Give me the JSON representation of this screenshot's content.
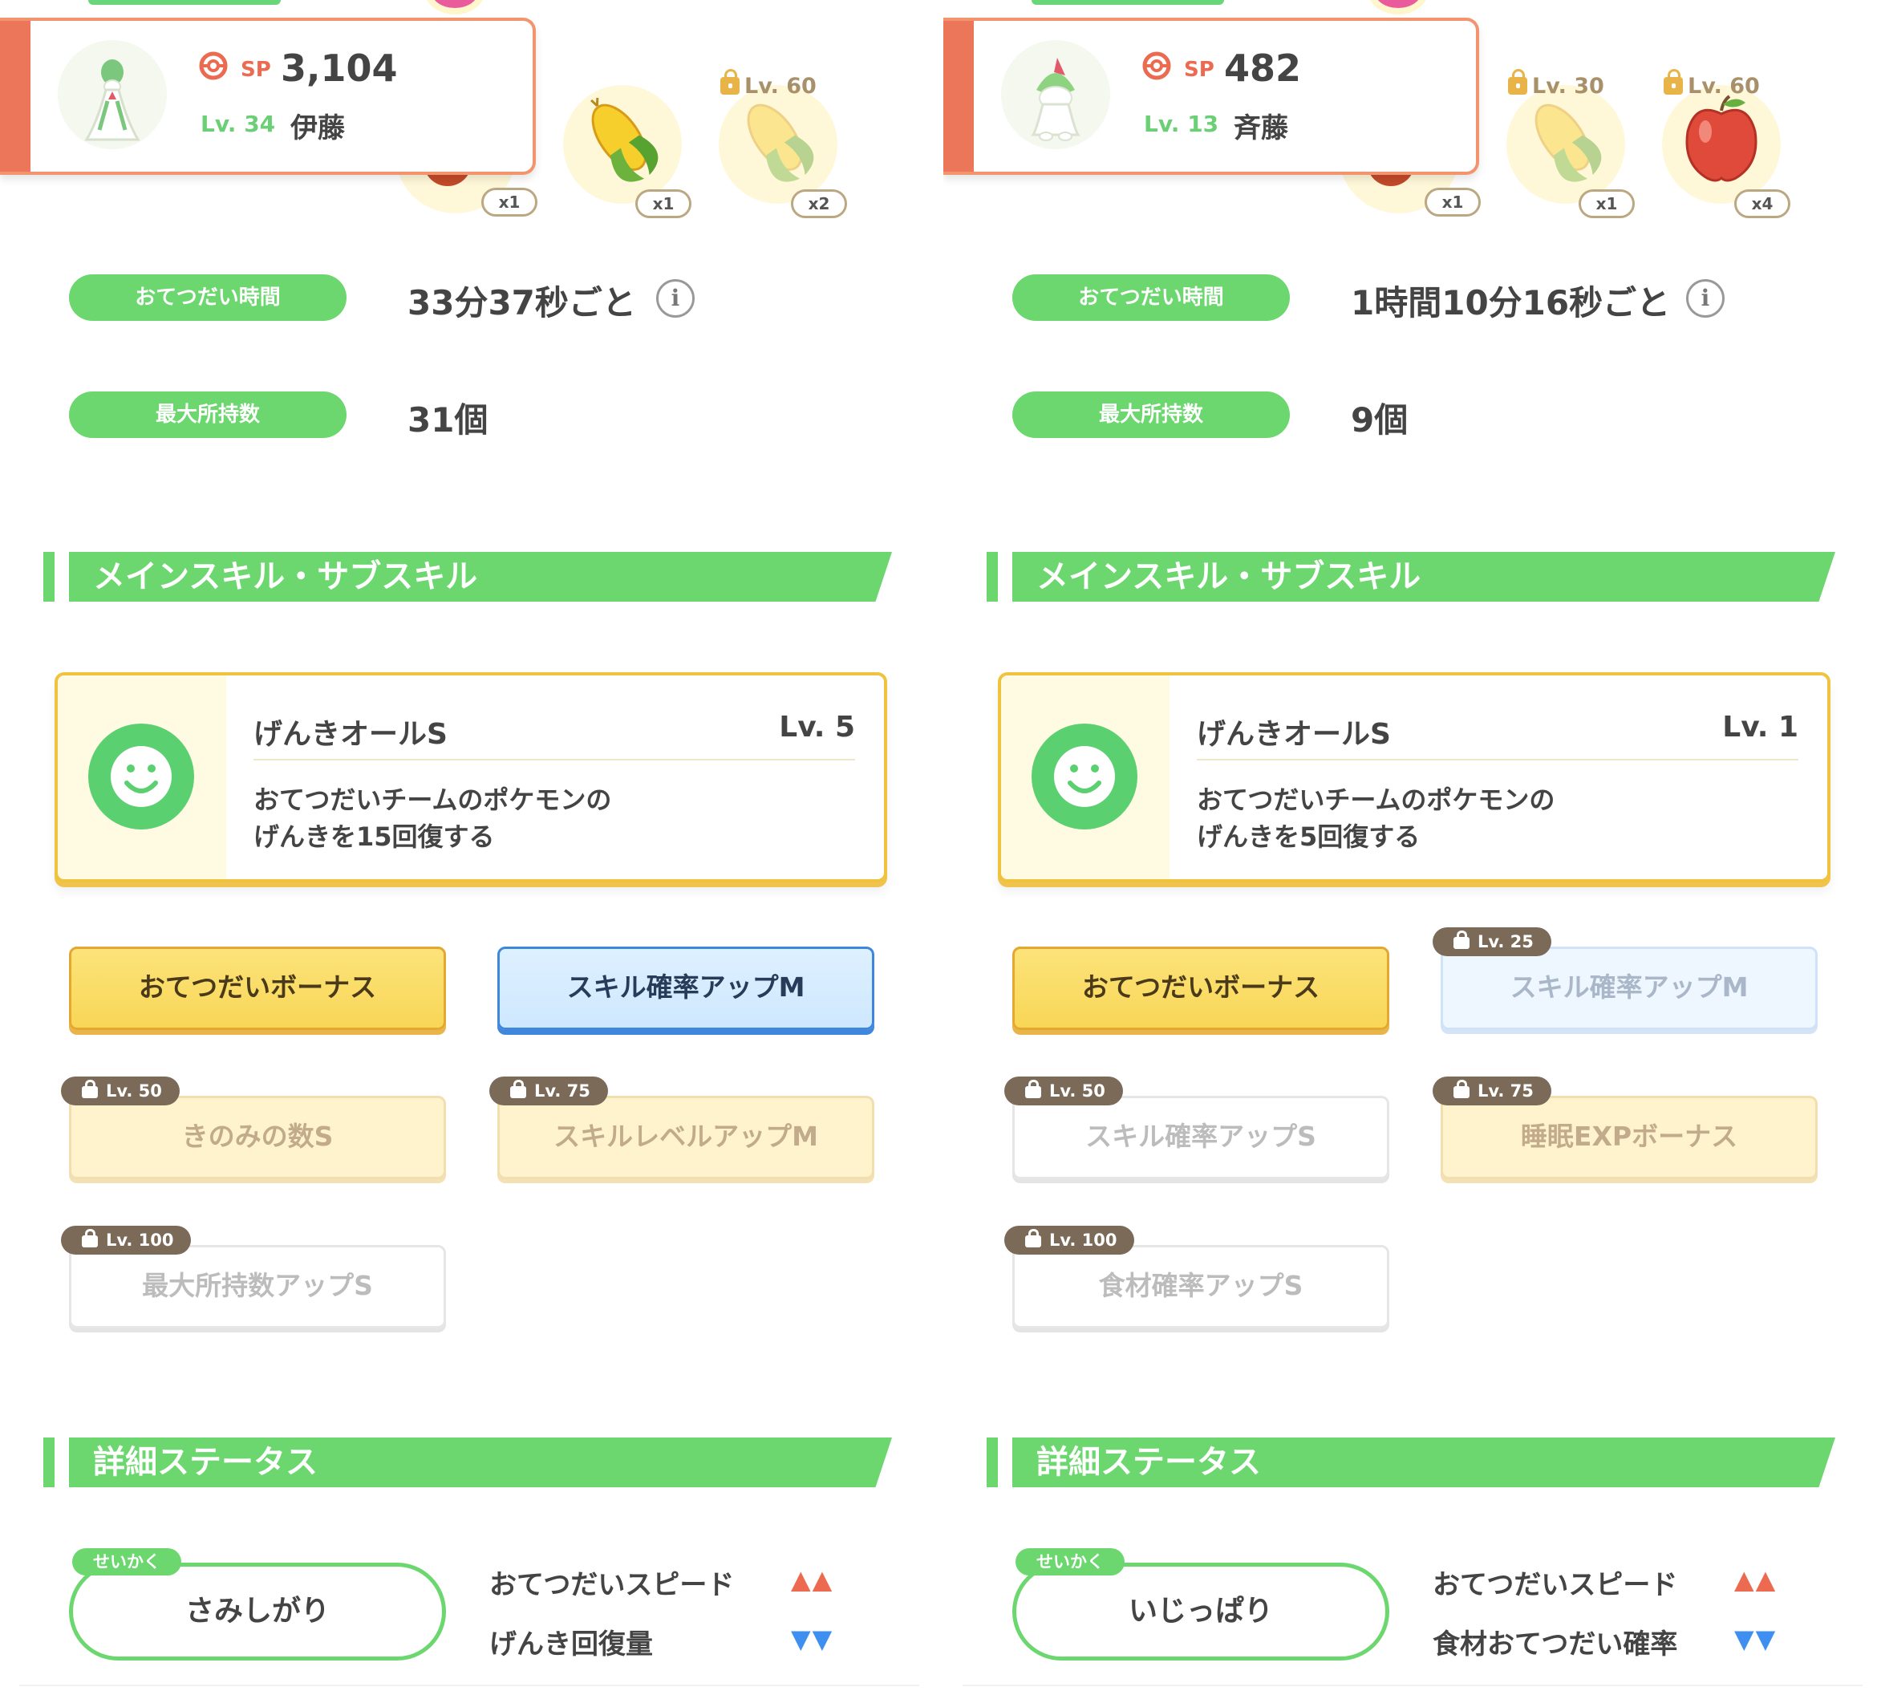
{
  "panels": [
    {
      "sp_label": "SP",
      "sp_value": "3,104",
      "level": "Lv. 34",
      "trainer": "伊藤",
      "ingredients": [
        {
          "icon": "corn-icon",
          "qty": "x1",
          "locked": false,
          "lock_level": ""
        },
        {
          "icon": "corn-icon",
          "qty": "x2",
          "locked": true,
          "lock_level": "Lv. 60"
        }
      ],
      "behind_qty": "x1",
      "help_time_label": "おてつだい時間",
      "help_time_value": "33分37秒ごと",
      "info_glyph": "i",
      "max_carry_label": "最大所持数",
      "max_carry_value": "31個",
      "skills_header": "メインスキル・サブスキル",
      "main_skill": {
        "name": "げんきオールS",
        "level": "Lv. 5",
        "desc_line1": "おてつだいチームのポケモンの",
        "desc_line2": "げんきを15回復する"
      },
      "sub_skills": [
        {
          "label": "おてつだいボーナス",
          "style": "gold",
          "locked": false,
          "lock_level": ""
        },
        {
          "label": "スキル確率アップM",
          "style": "blue",
          "locked": false,
          "lock_level": ""
        },
        {
          "label": "きのみの数S",
          "style": "gold",
          "locked": true,
          "lock_level": "Lv. 50"
        },
        {
          "label": "スキルレベルアップM",
          "style": "gold",
          "locked": true,
          "lock_level": "Lv. 75"
        },
        {
          "label": "最大所持数アップS",
          "style": "white",
          "locked": true,
          "lock_level": "Lv. 100"
        }
      ],
      "status_header": "詳細ステータス",
      "nature_tag": "せいかく",
      "nature": "さみしがり",
      "effects": [
        {
          "label": "おてつだいスピード",
          "arrows": "▲▲",
          "dir": "up"
        },
        {
          "label": "げんき回復量",
          "arrows": "▼▼",
          "dir": "down"
        }
      ]
    },
    {
      "sp_label": "SP",
      "sp_value": "482",
      "level": "Lv. 13",
      "trainer": "斉藤",
      "ingredients": [
        {
          "icon": "corn-icon",
          "qty": "x1",
          "locked": true,
          "lock_level": "Lv. 30"
        },
        {
          "icon": "apple-icon",
          "qty": "x4",
          "locked": true,
          "lock_level": "Lv. 60"
        }
      ],
      "behind_qty": "x1",
      "help_time_label": "おてつだい時間",
      "help_time_value": "1時間10分16秒ごと",
      "info_glyph": "i",
      "max_carry_label": "最大所持数",
      "max_carry_value": "9個",
      "skills_header": "メインスキル・サブスキル",
      "main_skill": {
        "name": "げんきオールS",
        "level": "Lv. 1",
        "desc_line1": "おてつだいチームのポケモンの",
        "desc_line2": "げんきを5回復する"
      },
      "sub_skills": [
        {
          "label": "おてつだいボーナス",
          "style": "gold",
          "locked": false,
          "lock_level": ""
        },
        {
          "label": "スキル確率アップM",
          "style": "blue",
          "locked": true,
          "lock_level": "Lv. 25"
        },
        {
          "label": "スキル確率アップS",
          "style": "white",
          "locked": true,
          "lock_level": "Lv. 50"
        },
        {
          "label": "睡眠EXPボーナス",
          "style": "gold",
          "locked": true,
          "lock_level": "Lv. 75"
        },
        {
          "label": "食材確率アップS",
          "style": "white",
          "locked": true,
          "lock_level": "Lv. 100"
        }
      ],
      "status_header": "詳細ステータス",
      "nature_tag": "せいかく",
      "nature": "いじっぱり",
      "effects": [
        {
          "label": "おてつだいスピード",
          "arrows": "▲▲",
          "dir": "up"
        },
        {
          "label": "食材おてつだい確率",
          "arrows": "▼▼",
          "dir": "down"
        }
      ]
    }
  ],
  "colors": {
    "accent_green": "#6bd76e",
    "orange_stripe": "#ec7659",
    "skill_gold": "#efc33e",
    "blue_border": "#3f86dd",
    "up_arrow": "#ec6a50",
    "down_arrow": "#3f8ff0"
  }
}
